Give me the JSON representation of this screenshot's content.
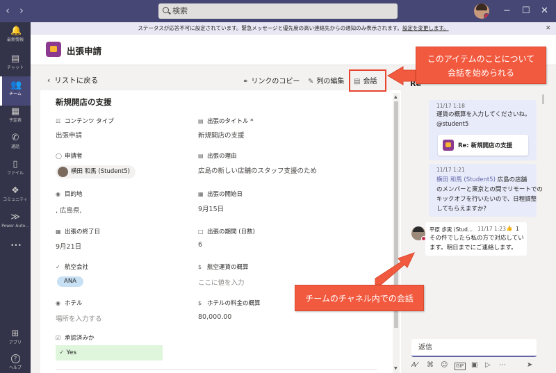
{
  "titlebar": {
    "back_icon": "chevron-left-icon",
    "forward_icon": "chevron-right-icon",
    "search_placeholder": "検索",
    "window_buttons": {
      "minimize": "−",
      "maximize": "☐",
      "close": "✕"
    }
  },
  "rail": {
    "items": [
      {
        "label": "最新情報",
        "icon": "bell-icon",
        "glyph": "🔔"
      },
      {
        "label": "チャット",
        "icon": "chat-icon",
        "glyph": "▤"
      },
      {
        "label": "チーム",
        "icon": "teams-icon",
        "glyph": "👥",
        "active": true
      },
      {
        "label": "予定表",
        "icon": "calendar-icon",
        "glyph": "▦"
      },
      {
        "label": "通話",
        "icon": "phone-icon",
        "glyph": "✆"
      },
      {
        "label": "ファイル",
        "icon": "file-icon",
        "glyph": "▯"
      },
      {
        "label": "コミュニティ",
        "icon": "community-icon",
        "glyph": "❖"
      },
      {
        "label": "Power Auto...",
        "icon": "power-automate-icon",
        "glyph": "≫"
      },
      {
        "label": "",
        "icon": "more-icon",
        "glyph": "•••"
      }
    ],
    "bottom": [
      {
        "label": "アプリ",
        "icon": "apps-icon",
        "glyph": "⊞"
      },
      {
        "label": "ヘルプ",
        "icon": "help-icon",
        "glyph": "?"
      }
    ]
  },
  "banner": {
    "text": "ステータスが応答不可に設定されています。緊急メッセージと優先度の高い連絡先からの通知のみ表示されます。",
    "link": "設定を変更します。",
    "close": "✕"
  },
  "header": {
    "title": "出張申請"
  },
  "toolbar": {
    "back_label": "リストに戻る",
    "copy_link": "リンクのコピー",
    "edit_columns": "列の編集",
    "conversation": "会話"
  },
  "form": {
    "title": "新規開店の支援",
    "fields": {
      "content_type": {
        "label": "コンテンツ タイプ",
        "icon": "content-type-icon",
        "value": "出張申請"
      },
      "trip_title": {
        "label": "出張のタイトル *",
        "icon": "text-field-icon",
        "value": "新規開店の支援"
      },
      "applicant": {
        "label": "申請者",
        "icon": "person-icon",
        "value": "横田 和馬 (Student5)"
      },
      "reason": {
        "label": "出張の理由",
        "icon": "text-field-icon",
        "value": "広島の新しい店舗のスタッフ支援のため"
      },
      "destination": {
        "label": "目的地",
        "icon": "location-icon",
        "value": ", 広島県,"
      },
      "start_date": {
        "label": "出張の開始日",
        "icon": "calendar-icon",
        "value": "9月15日"
      },
      "end_date": {
        "label": "出張の終了日",
        "icon": "calendar-icon",
        "value": "9月21日"
      },
      "duration": {
        "label": "出張の期間 (日数)",
        "icon": "number-icon",
        "value": "6"
      },
      "airline": {
        "label": "航空会社",
        "icon": "choice-icon",
        "value": "ANA"
      },
      "airfare": {
        "label": "航空運賃の概算",
        "icon": "currency-icon",
        "placeholder": "ここに値を入力"
      },
      "hotel": {
        "label": "ホテル",
        "icon": "location-icon",
        "placeholder": "場所を入力する"
      },
      "hotel_cost": {
        "label": "ホテルの料金の概算",
        "icon": "currency-icon",
        "value": "80,000.00"
      },
      "approved": {
        "label": "承認済みか",
        "icon": "checkbox-icon",
        "value": "Yes"
      }
    }
  },
  "chat": {
    "header": "Re",
    "messages": [
      {
        "time": "11/17 1:18",
        "lines": [
          "運賃の概算を入力してくださいね。",
          "@student5"
        ],
        "card_title": "Re: 新規開店の支援"
      },
      {
        "time": "11/17 1:21",
        "mention": "横田 和馬 (Student5)",
        "lines": [
          " 広島の店舗",
          "のメンバーと東京との間でリモートでの",
          "キックオフを行いたいので、日程調整",
          "してもらえますか?"
        ]
      },
      {
        "author": "平原 歩実 (Stud...",
        "time": "11/17 1:23",
        "reaction": "👍",
        "reaction_count": "1",
        "lines": [
          "その件でしたら私の方で対応してい",
          "ます。明日までにご連絡します。"
        ]
      }
    ],
    "reply_placeholder": "返信",
    "compose_icons": [
      "format-icon",
      "attach-icon",
      "emoji-icon",
      "gif-icon",
      "sticker-icon",
      "meet-icon",
      "more-icon",
      "send-icon"
    ]
  },
  "annotations": {
    "callout_top": [
      "このアイテムのことについて",
      "会話を始められる"
    ],
    "callout_bottom": "チームのチャネル内での会話",
    "accent": "#f25a3f"
  },
  "colors": {
    "titlebar": "#464775",
    "rail": "#33344a",
    "accent": "#6264a7",
    "approved_bg": "#dff6dd",
    "chip_bg": "#c7e0f4"
  }
}
